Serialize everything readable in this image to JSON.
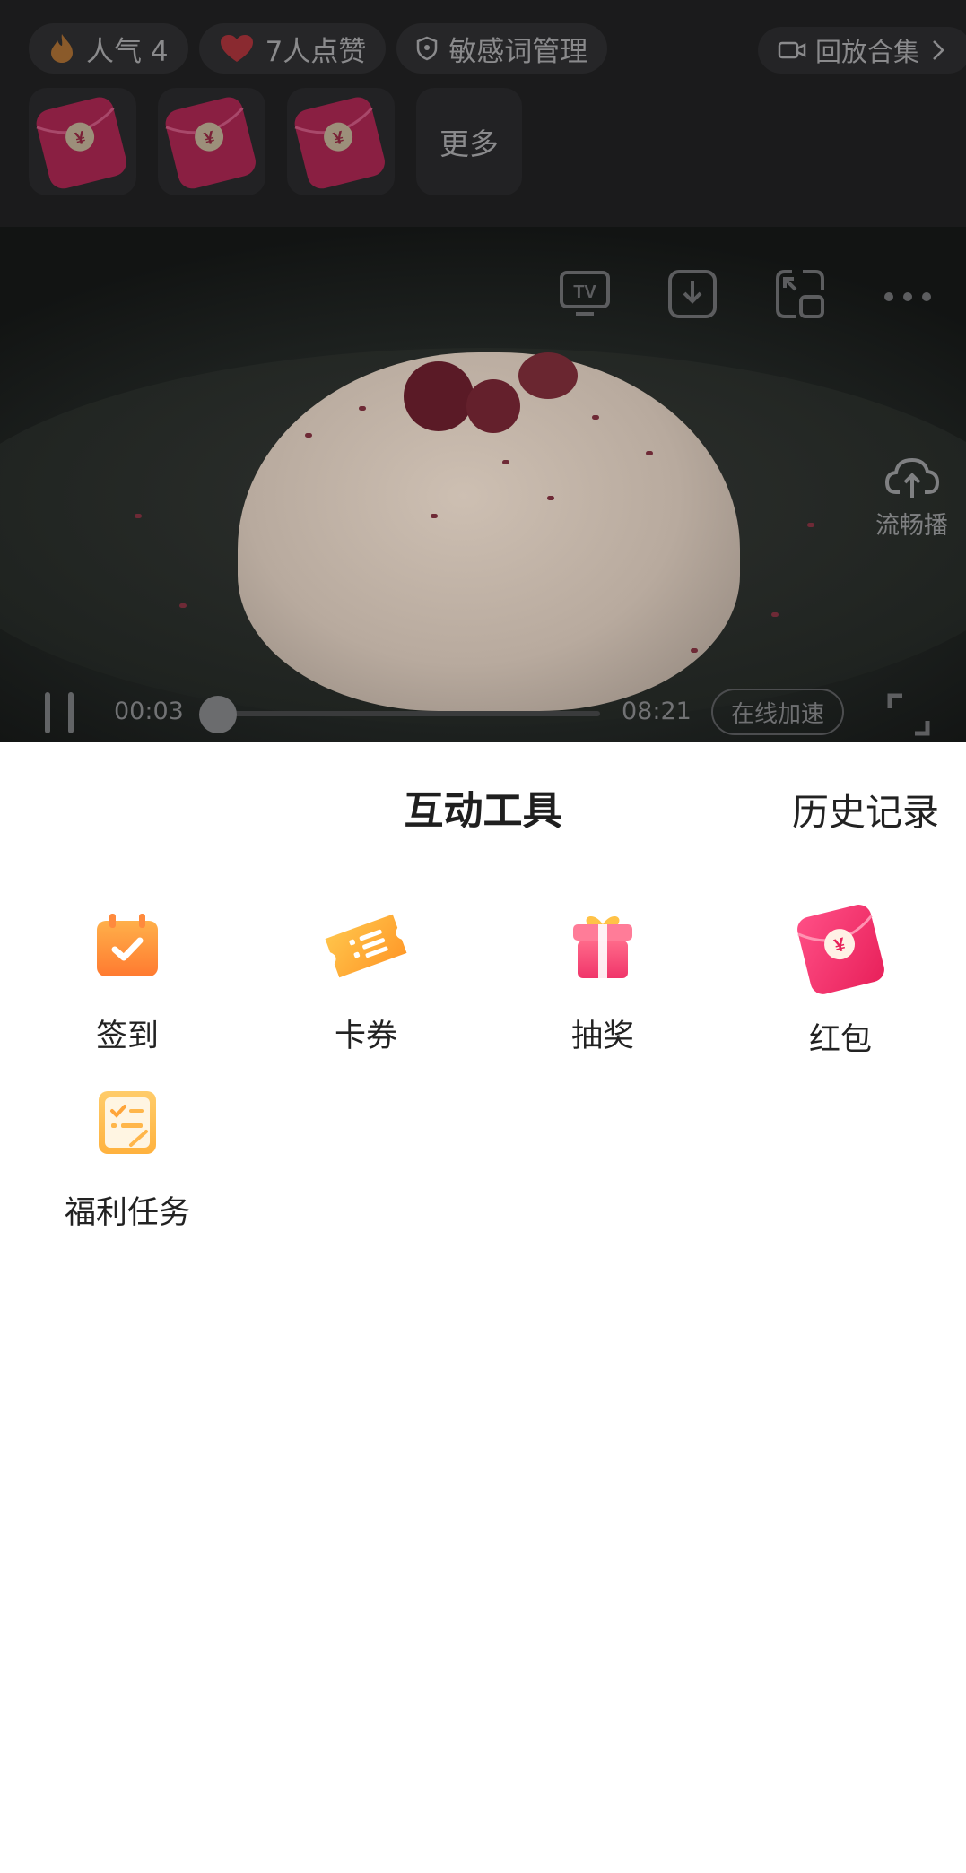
{
  "top_bar": {
    "popularity": "人气 4",
    "likes": "7人点赞",
    "sensitive": "敏感词管理",
    "replay": "回放合集"
  },
  "redpack_tiles": {
    "more": "更多"
  },
  "video": {
    "smooth_label": "流畅播",
    "current_time": "00:03",
    "total_time": "08:21",
    "boost_label": "在线加速",
    "progress": 0.006
  },
  "sheet": {
    "title": "互动工具",
    "history": "历史记录",
    "tools": [
      {
        "label": "签到",
        "icon": "calendar-check-icon"
      },
      {
        "label": "卡券",
        "icon": "coupon-icon"
      },
      {
        "label": "抽奖",
        "icon": "gift-box-icon"
      },
      {
        "label": "红包",
        "icon": "red-packet-icon"
      },
      {
        "label": "福利任务",
        "icon": "task-checklist-icon"
      }
    ]
  },
  "colors": {
    "accent_red": "#f0356a",
    "accent_orange": "#ff8a3d",
    "sheet_bg": "#ffffff",
    "overlay_dark": "#1b1b1c"
  }
}
